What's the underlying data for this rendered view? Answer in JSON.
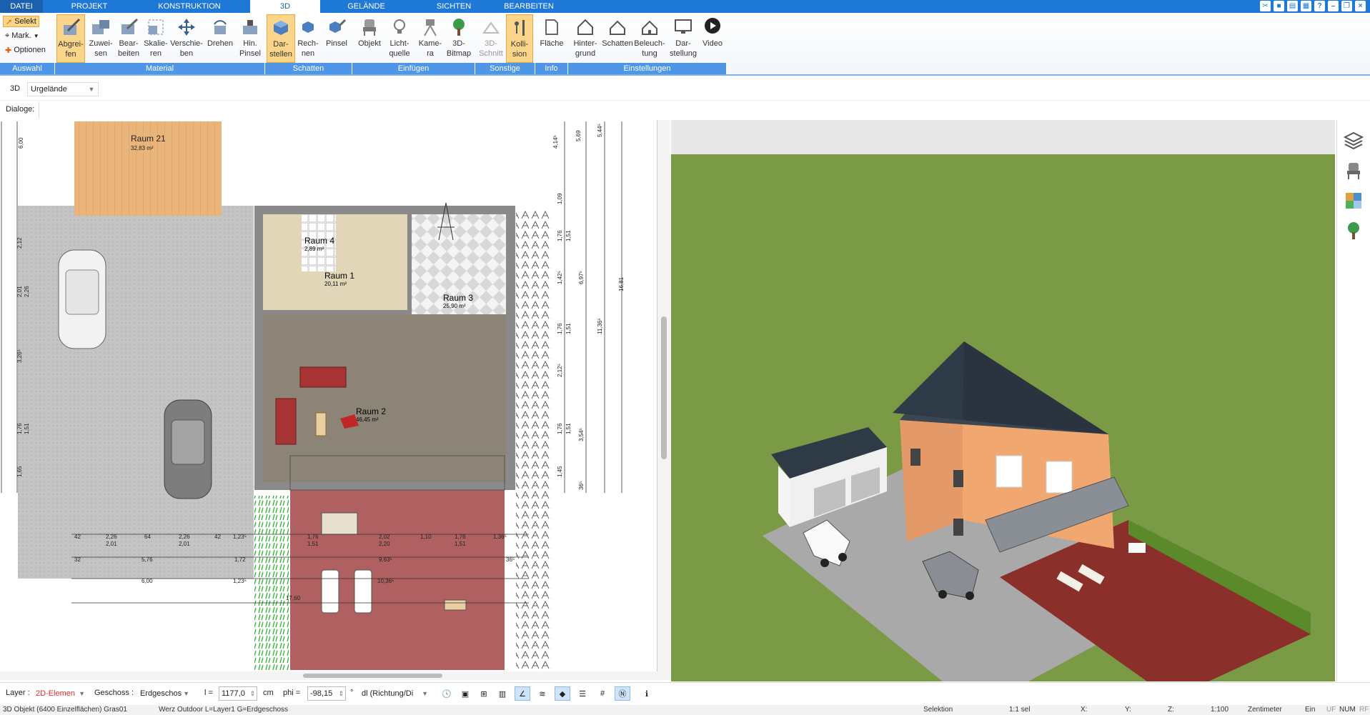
{
  "tabs": [
    "DATEI",
    "PROJEKT",
    "KONSTRUKTION",
    "3D",
    "GELÄNDE",
    "SICHTEN",
    "BEARBEITEN"
  ],
  "selection": {
    "selekt": "Selekt",
    "mark": "Mark.",
    "optionen": "Optionen"
  },
  "ribbon": {
    "material": [
      "Abgrei-\nfen",
      "Zuwei-\nsen",
      "Bear-\nbeiten",
      "Skalie-\nren",
      "Verschie-\nben",
      "Drehen",
      "Hin.\nPinsel"
    ],
    "schatten": [
      "Dar-\nstellen",
      "Rech-\nnen",
      "Pinsel"
    ],
    "einfuegen": [
      "Objekt",
      "Licht-\nquelle",
      "Kame-\nra",
      "3D-\nBitmap"
    ],
    "sonstige": [
      "3D-\nSchnitt",
      "Kolli-\nsion"
    ],
    "info": [
      "Fläche"
    ],
    "einstellungen": [
      "Hinter-\ngrund",
      "Schatten",
      "Beleuch-\ntung",
      "Dar-\nstellung",
      "Video"
    ]
  },
  "groups": [
    "Auswahl",
    "Material",
    "Schatten",
    "Einfügen",
    "Sonstige",
    "Info",
    "Einstellungen"
  ],
  "floorbar": {
    "label": "3D",
    "floor": "Urgelände"
  },
  "dialoge_label": "Dialoge:",
  "plan": {
    "rooms": [
      {
        "name": "Raum 21",
        "area": "32,83 m²"
      },
      {
        "name": "Raum 4",
        "area": "2,89 m²"
      },
      {
        "name": "Raum 1",
        "area": "20,11 m²"
      },
      {
        "name": "Raum 3",
        "area": "25,90 m²"
      },
      {
        "name": "Raum 2",
        "area": "46,45 m²"
      }
    ],
    "dims_right": [
      "5,44⁵",
      "4,14⁵",
      "5,69",
      "1,09",
      "1,76",
      "1,51",
      "1,42⁵",
      "6,97⁵",
      "11,36⁵",
      "16,81",
      "1,76",
      "1,51",
      "2,12⁵",
      "1,76",
      "1,51",
      "3,54⁵",
      "1,45",
      "36⁵"
    ],
    "dims_left": [
      "6,00",
      "2,12",
      "2,01",
      "2,26",
      "3,26⁵",
      "1,76",
      "1,51",
      "1,65"
    ],
    "dims_bottom_row1": [
      "42",
      "2,26",
      "64",
      "2,26",
      "42",
      "1,23⁵",
      "1,76",
      "2,02",
      "1,10",
      "1,76",
      "1,36⁵"
    ],
    "dims_bottom_row2": [
      "2,01",
      "2,01",
      "1,51",
      "2,20",
      "1,51"
    ],
    "dims_bottom_row3": [
      "32",
      "5,76",
      "1,72",
      "9,63⁵",
      "36⁵"
    ],
    "dims_bottom_row4": [
      "6,00",
      "1,23⁵",
      "10,36⁵"
    ],
    "dims_bottom_row5": [
      "17,60"
    ]
  },
  "bottom": {
    "layer_label": "Layer :",
    "layer_value": "2D-Elemen",
    "geschoss_label": "Geschoss :",
    "geschoss_value": "Erdgeschos",
    "l_label": "l =",
    "l_value": "1177,0",
    "l_unit": "cm",
    "phi_label": "phi =",
    "phi_value": "-98,15",
    "phi_unit": "°",
    "dir_value": "dl (Richtung/Di"
  },
  "status": {
    "left": "3D Objekt (6400 Einzelflächen) Gras01",
    "mid": "Werz Outdoor L=Layer1 G=Erdgeschoss",
    "selektion": "Selektion",
    "sel": "1:1 sel",
    "x": "X:",
    "y": "Y:",
    "z": "Z:",
    "scale": "1:100",
    "unit": "Zentimeter",
    "ein": "Ein",
    "uf": "UF",
    "num": "NUM",
    "rf": "RF"
  },
  "colors": {
    "tabbar": "#1e78d6",
    "group": "#4f97e6",
    "active_btn": "#fbd58a",
    "grass": "#7a9a46",
    "roof": "#2f3a47",
    "wall": "#e39a68",
    "terrace": "#8b2f2a",
    "driveway": "#a9a9a9"
  }
}
